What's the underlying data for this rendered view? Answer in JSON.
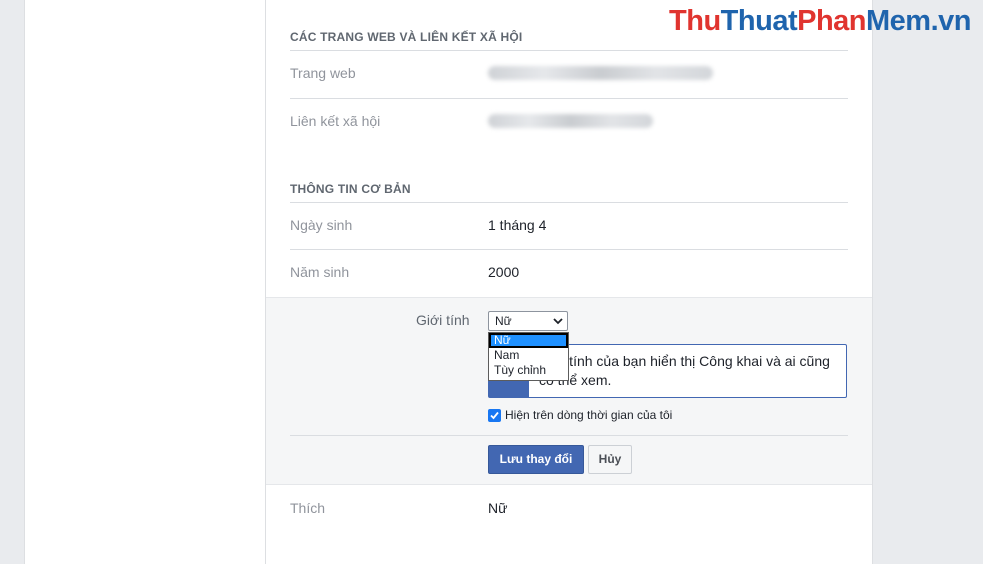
{
  "watermark": {
    "part1": "Thu",
    "part2": "Thuat",
    "part3": "Phan",
    "part4": "Mem",
    "suffix": ".vn"
  },
  "sections": {
    "web_social": {
      "title": "CÁC TRANG WEB VÀ LIÊN KẾT XÃ HỘI",
      "website_label": "Trang web",
      "social_label": "Liên kết xã hội"
    },
    "basic_info": {
      "title": "THÔNG TIN CƠ BẢN",
      "birthday_label": "Ngày sinh",
      "birthday_value": "1 tháng 4",
      "birthyear_label": "Năm sinh",
      "birthyear_value": "2000"
    }
  },
  "gender_editor": {
    "label": "Giới tính",
    "selected": "Nữ",
    "options": [
      "Nữ",
      "Nam",
      "Tùy chỉnh"
    ],
    "info_text": "Giới tính của bạn hiển thị Công khai và ai cũng có thể xem.",
    "show_on_timeline": "Hiện trên dòng thời gian của tôi",
    "save_label": "Lưu thay đổi",
    "cancel_label": "Hủy"
  },
  "interested_in": {
    "label": "Thích",
    "value": "Nữ"
  },
  "colors": {
    "accent": "#4267b2",
    "checkbox": "#1877f2",
    "dropdown_highlight": "#1e90ff"
  }
}
